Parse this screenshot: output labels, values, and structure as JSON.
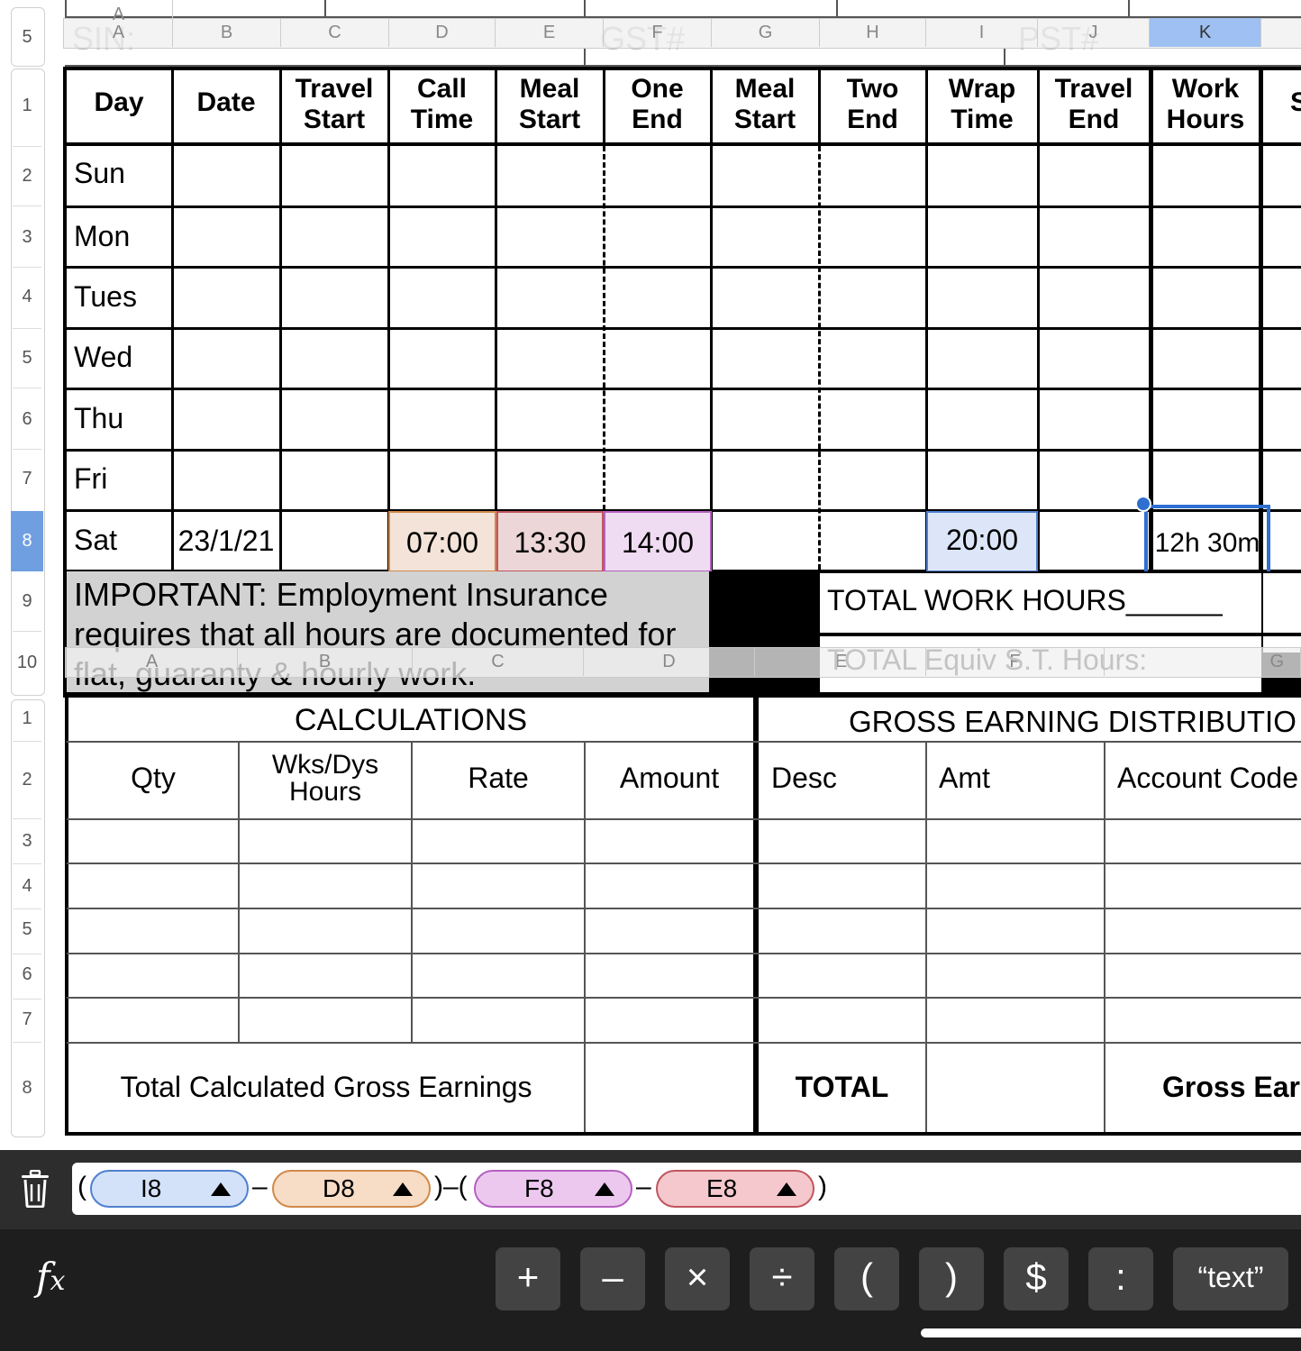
{
  "row_numbers_top": [
    "5",
    "1",
    "2",
    "3",
    "4",
    "5",
    "6",
    "7",
    "8",
    "9",
    "10"
  ],
  "row_numbers_bottom": [
    "1",
    "2",
    "3",
    "4",
    "5",
    "6",
    "7",
    "8"
  ],
  "ghost_header_top": {
    "columns": [
      "A",
      "B",
      "C",
      "D",
      "E",
      "F",
      "G",
      "H",
      "I",
      "J",
      "K"
    ],
    "faint_labels": {
      "sin": "SIN:",
      "gst": "GST#",
      "pst": "PST#"
    }
  },
  "ghost_header_mid": {
    "columns": [
      "A",
      "B",
      "C",
      "D",
      "E",
      "F",
      "G"
    ],
    "faint_label": "TOTAL Equiv S.T. Hours:"
  },
  "timesheet": {
    "headers": [
      [
        "Day"
      ],
      [
        "Date"
      ],
      [
        "Travel",
        "Start"
      ],
      [
        "Call",
        "Time"
      ],
      [
        "Meal",
        "Start"
      ],
      [
        "One",
        "End"
      ],
      [
        "Meal",
        "Start"
      ],
      [
        "Two",
        "End"
      ],
      [
        "Wrap",
        "Time"
      ],
      [
        "Travel",
        "End"
      ],
      [
        "Work",
        "Hours"
      ],
      [
        "S"
      ]
    ],
    "days": [
      "Sun",
      "Mon",
      "Tues",
      "Wed",
      "Thu",
      "Fri",
      "Sat"
    ],
    "sat_row": {
      "date": "23/1/21",
      "call_time": "07:00",
      "meal_start": "13:30",
      "one_end": "14:00",
      "wrap_time": "20:00",
      "work_hours": "12h 30m"
    },
    "important_note": "IMPORTANT: Employment Insurance requires that all hours are documented for flat, guaranty & hourly work.",
    "total_work_hours": "TOTAL WORK HOURS______"
  },
  "calculations": {
    "title": "CALCULATIONS",
    "headers": [
      "Qty",
      "Wks/Dys\nHours",
      "Rate",
      "Amount"
    ],
    "total_label": "Total Calculated Gross Earnings"
  },
  "gross_distribution": {
    "title": "GROSS EARNING DISTRIBUTIO",
    "headers": [
      "Desc",
      "Amt",
      "Account Code"
    ],
    "total_label": "TOTAL",
    "gross_label": "Gross Ear"
  },
  "formula": {
    "open1": "(",
    "tokens": [
      {
        "ref": "I8",
        "color": "#d4e2f9",
        "border": "#4f7fd0"
      },
      {
        "ref": "D8",
        "color": "#f7dcc6",
        "border": "#d08a4a"
      },
      {
        "ref": "F8",
        "color": "#ecc8ef",
        "border": "#b460c0"
      },
      {
        "ref": "E8",
        "color": "#f4c8cc",
        "border": "#c0555e"
      }
    ],
    "minus": "–",
    "mid": ")–(",
    "close": ")"
  },
  "keypad": {
    "fx": "fx",
    "keys": [
      "+",
      "–",
      "×",
      "÷",
      "(",
      ")",
      "$",
      ":",
      "“text”"
    ]
  },
  "cell_colors": {
    "call_time": "#f3e3d9",
    "meal_start": "#ecd6d8",
    "one_end": "#f0dcf2",
    "wrap_time": "#dde6f8",
    "selection": "#2f6fd0"
  }
}
